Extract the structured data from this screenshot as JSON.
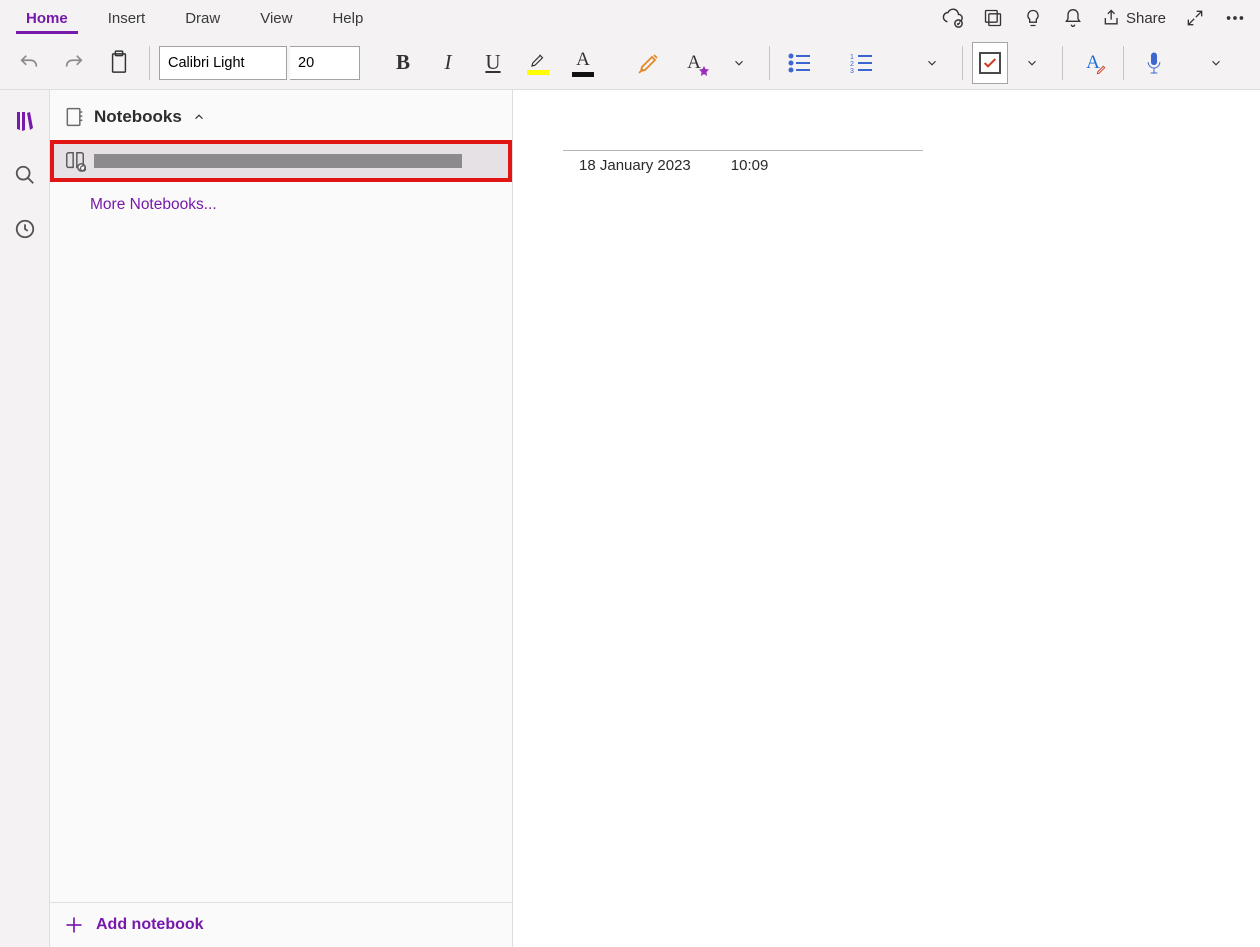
{
  "tabs": {
    "home": "Home",
    "insert": "Insert",
    "draw": "Draw",
    "view": "View",
    "help": "Help"
  },
  "header": {
    "share_label": "Share"
  },
  "ribbon": {
    "font_name": "Calibri Light",
    "font_size": "20"
  },
  "sidebar": {
    "title": "Notebooks",
    "more_label": "More Notebooks...",
    "add_label": "Add notebook"
  },
  "note": {
    "date": "18 January 2023",
    "time": "10:09"
  }
}
